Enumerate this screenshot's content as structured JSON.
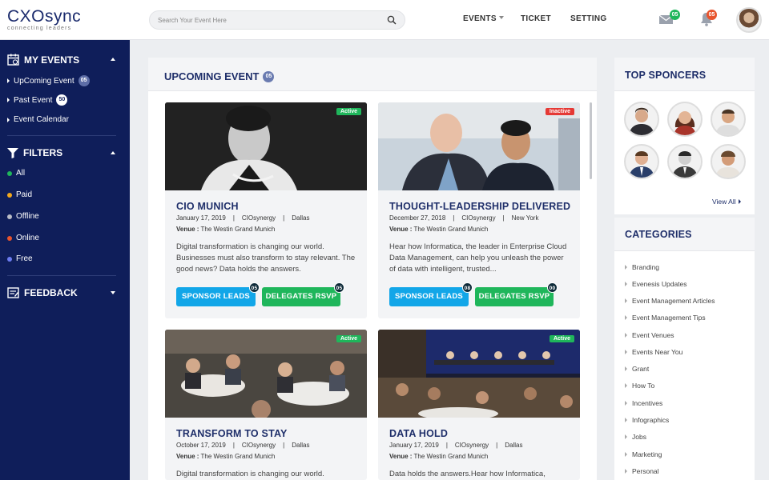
{
  "header": {
    "logo_main": "CXOsync",
    "logo_sub": "connecting leaders",
    "search_placeholder": "Search Your Event Here",
    "nav": [
      {
        "label": "EVENTS",
        "has_dropdown": true
      },
      {
        "label": "TICKET"
      },
      {
        "label": "SETTING"
      }
    ],
    "mail_badge": "05",
    "bell_badge": "05"
  },
  "sidebar": {
    "my_events": {
      "title": "MY EVENTS",
      "items": [
        {
          "label": "UpComing Event",
          "badge": "05"
        },
        {
          "label": "Past Event",
          "badge": "50"
        },
        {
          "label": "Event Calendar"
        }
      ]
    },
    "filters": {
      "title": "FILTERS",
      "items": [
        {
          "label": "All",
          "color": "#1fb65b"
        },
        {
          "label": "Paid",
          "color": "#f2a81d"
        },
        {
          "label": "Offline",
          "color": "#b9bcc6"
        },
        {
          "label": "Online",
          "color": "#e8542d"
        },
        {
          "label": "Free",
          "color": "#6b7bf0"
        }
      ]
    },
    "feedback": {
      "title": "FEEDBACK"
    }
  },
  "main": {
    "title": "UPCOMING EVENT",
    "badge": "05",
    "cards": [
      {
        "status": "Active",
        "title": "CIO MUNICH",
        "date": "January 17, 2019",
        "org": "CIOsynergy",
        "city": "Dallas",
        "venue_label": "Venue :",
        "venue": "The Westin Grand Munich",
        "desc": "Digital transformation is changing our world. Businesses must also transform to stay relevant. The good news? Data holds the answers.",
        "btn1": "SPONSOR LEADS",
        "btn1_badge": "05",
        "btn2": "DELEGATES RSVP",
        "btn2_badge": "05"
      },
      {
        "status": "Inactive",
        "title": "THOUGHT-LEADERSHIP DELIVERED",
        "date": "December 27, 2018",
        "org": "CIOsynergy",
        "city": "New York",
        "venue_label": "Venue :",
        "venue": "The Westin Grand Munich",
        "desc": "Hear how Informatica, the leader in Enterprise Cloud Data Management, can help you unleash the power of data with intelligent, trusted...",
        "btn1": "SPONSOR LEADS",
        "btn1_badge": "08",
        "btn2": "DELEGATES RSVP",
        "btn2_badge": "00"
      },
      {
        "status": "Active",
        "title": "TRANSFORM TO STAY",
        "date": "October 17, 2019",
        "org": "CIOsynergy",
        "city": "Dallas",
        "venue_label": "Venue :",
        "venue": "The Westin Grand Munich",
        "desc": "Digital transformation is changing our world."
      },
      {
        "status": "Active",
        "title": "DATA HOLD",
        "date": "January 17, 2019",
        "org": "CIOsynergy",
        "city": "Dallas",
        "venue_label": "Venue :",
        "venue": "The Westin Grand Munich",
        "desc": "Data holds the answers.Hear how Informatica,"
      }
    ]
  },
  "sponsors": {
    "title": "TOP SPONCERS",
    "view_all": "View All"
  },
  "categories": {
    "title": "CATEGORIES",
    "items": [
      "Branding",
      "Evenesis Updates",
      "Event Management Articles",
      "Event Management Tips",
      "Event Venues",
      "Events Near You",
      "Grant",
      "How To",
      "Incentives",
      "Infographics",
      "Jobs",
      "Marketing",
      "Personal"
    ]
  }
}
